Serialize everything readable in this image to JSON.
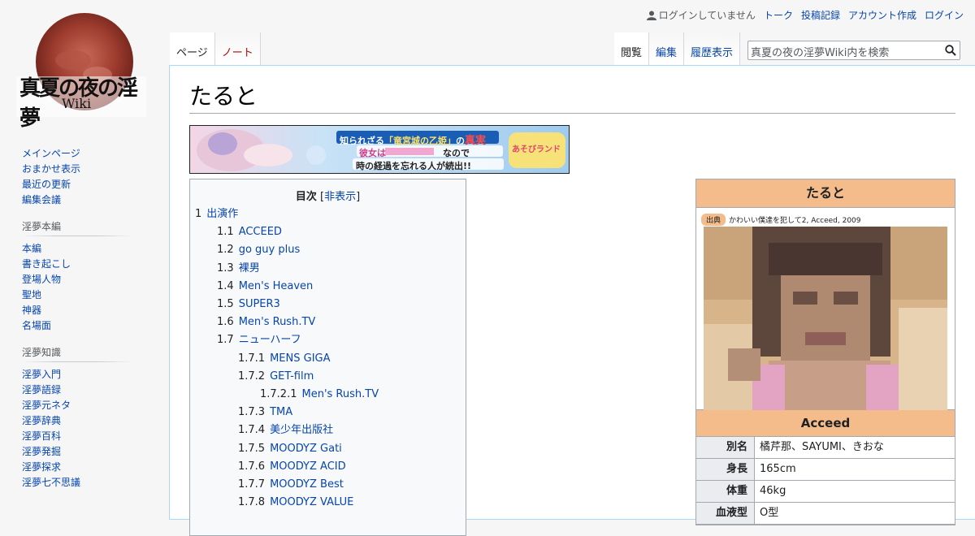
{
  "personal": {
    "user_status": "ログインしていません",
    "links": [
      "トーク",
      "投稿記録",
      "アカウント作成",
      "ログイン"
    ]
  },
  "logo": {
    "text_main": "真夏の夜の淫夢",
    "text_sub": "Wiki"
  },
  "sidebar": {
    "nav": [
      "メインページ",
      "おまかせ表示",
      "最近の更新",
      "編集会議"
    ],
    "sections": [
      {
        "heading": "淫夢本編",
        "items": [
          "本編",
          "書き起こし",
          "登場人物",
          "聖地",
          "神器",
          "名場面"
        ]
      },
      {
        "heading": "淫夢知識",
        "items": [
          "淫夢入門",
          "淫夢語録",
          "淫夢元ネタ",
          "淫夢辞典",
          "淫夢百科",
          "淫夢発掘",
          "淫夢探求",
          "淫夢七不思議"
        ]
      }
    ]
  },
  "tabs": {
    "left": [
      {
        "label": "ページ"
      },
      {
        "label": "ノート"
      }
    ],
    "right": [
      {
        "label": "閲覧"
      },
      {
        "label": "編集"
      },
      {
        "label": "履歴表示"
      }
    ]
  },
  "search": {
    "placeholder": "真夏の夜の淫夢Wiki内を検索"
  },
  "page": {
    "title": "たると"
  },
  "banner": {
    "line1a": "知られざる",
    "line1b": "「竜宮城の乙姫」",
    "line1c": "の",
    "line1d": "真実",
    "line2a": "彼女は",
    "line2b": "なので",
    "line3": "時の経過を忘れる人が続出!!",
    "badge": "あそびランド"
  },
  "toc": {
    "title": "目次",
    "toggle_open": "[",
    "toggle": "非表示",
    "toggle_close": "]",
    "entries": [
      {
        "num": "1",
        "label": "出演作",
        "level": 1
      },
      {
        "num": "1.1",
        "label": "ACCEED",
        "level": 2
      },
      {
        "num": "1.2",
        "label": "go guy plus",
        "level": 2
      },
      {
        "num": "1.3",
        "label": "裸男",
        "level": 2
      },
      {
        "num": "1.4",
        "label": "Men's Heaven",
        "level": 2
      },
      {
        "num": "1.5",
        "label": "SUPER3",
        "level": 2
      },
      {
        "num": "1.6",
        "label": "Men's Rush.TV",
        "level": 2
      },
      {
        "num": "1.7",
        "label": "ニューハーフ",
        "level": 2
      },
      {
        "num": "1.7.1",
        "label": "MENS GIGA",
        "level": 3
      },
      {
        "num": "1.7.2",
        "label": "GET-film",
        "level": 3
      },
      {
        "num": "1.7.2.1",
        "label": "Men's Rush.TV",
        "level": 4
      },
      {
        "num": "1.7.3",
        "label": "TMA",
        "level": 3
      },
      {
        "num": "1.7.4",
        "label": "美少年出版社",
        "level": 3
      },
      {
        "num": "1.7.5",
        "label": "MOODYZ Gati",
        "level": 3
      },
      {
        "num": "1.7.6",
        "label": "MOODYZ ACID",
        "level": 3
      },
      {
        "num": "1.7.7",
        "label": "MOODYZ Best",
        "level": 3
      },
      {
        "num": "1.7.8",
        "label": "MOODYZ VALUE",
        "level": 3
      }
    ]
  },
  "infobox": {
    "title": "たると",
    "source_tag": "出典",
    "source_text": "かわいい僕達を犯して2, Acceed, 2009",
    "subheader": "Acceed",
    "rows": [
      {
        "key": "別名",
        "value": "橘芹那、SAYUMI、きおな"
      },
      {
        "key": "身長",
        "value": "165cm"
      },
      {
        "key": "体重",
        "value": "46kg"
      },
      {
        "key": "血液型",
        "value": "O型"
      }
    ]
  },
  "colors": {
    "accent": "#f4bc8b",
    "link": "#0645ad",
    "redlink": "#ba0000"
  }
}
